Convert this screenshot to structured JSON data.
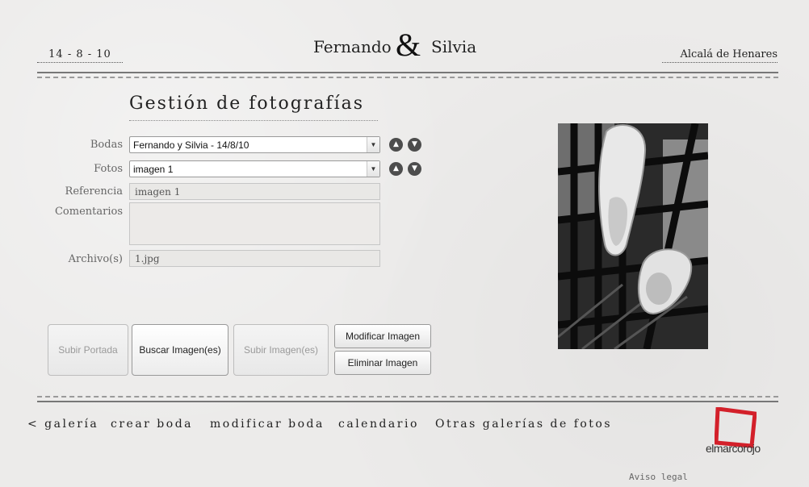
{
  "header": {
    "date": "14 - 8 - 10",
    "name_left": "Fernando",
    "ampersand": "&",
    "name_right": "Silvia",
    "place": "Alcalá de Henares"
  },
  "page_title": "Gestión de fotografías",
  "form": {
    "bodas_label": "Bodas",
    "bodas_value": "Fernando y Silvia - 14/8/10",
    "fotos_label": "Fotos",
    "fotos_value": "imagen 1",
    "referencia_label": "Referencia",
    "referencia_value": "imagen 1",
    "comentarios_label": "Comentarios",
    "comentarios_value": "",
    "archivo_label": "Archivo(s)",
    "archivo_value": "1.jpg"
  },
  "buttons": {
    "subir_portada": "Subir Portada",
    "buscar_imagen": "Buscar Imagen(es)",
    "subir_imagen": "Subir Imagen(es)",
    "modificar_imagen": "Modificar Imagen",
    "eliminar_imagen": "Eliminar Imagen"
  },
  "icons": {
    "up": "arrow-up-circle-icon",
    "down": "arrow-down-circle-icon"
  },
  "nav": {
    "galeria": "< galería",
    "crear_boda": "crear boda",
    "modificar_boda": "modificar boda",
    "calendario": "calendario",
    "otras_galerias": "Otras galerías de fotos"
  },
  "logo": {
    "text": "elmarcorojo",
    "color": "#d3202a"
  },
  "footer": {
    "aviso_legal": "Aviso legal"
  }
}
